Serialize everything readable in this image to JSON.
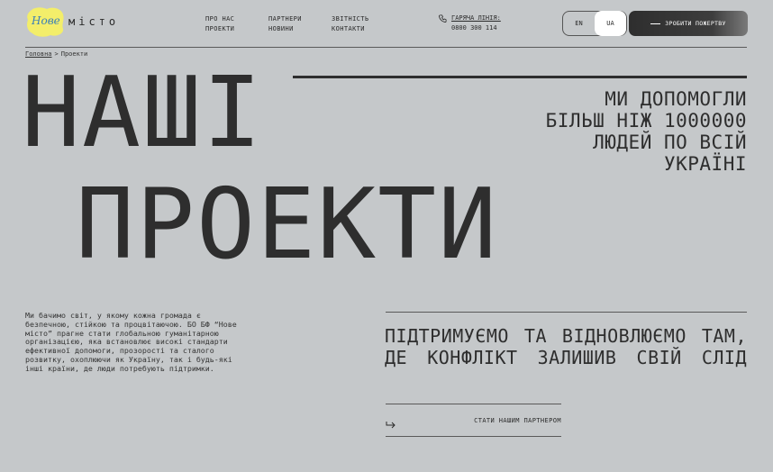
{
  "logo": {
    "script": "Нове",
    "word": "місто"
  },
  "nav": {
    "col1": [
      "ПРО НАС",
      "ПРОЕКТИ"
    ],
    "col2": [
      "ПАРТНЕРИ",
      "НОВИНИ"
    ],
    "col3": [
      "ЗВІТНІСТЬ",
      "КОНТАКТИ"
    ]
  },
  "hotline": {
    "label": "ГАРЯЧА ЛІНІЯ:",
    "phone": "0800 300 114",
    "icon": "phone-icon"
  },
  "languages": {
    "en": "EN",
    "ua": "UA",
    "active": "UA"
  },
  "donate_button": "ЗРОБИТИ ПОЖЕРТВУ",
  "breadcrumb": {
    "home": "Головна",
    "separator": ">",
    "current": "Проекти"
  },
  "hero": {
    "title_line_1": "НАШІ",
    "title_line_2": "ПРОЕКТИ",
    "stat_lines": [
      "МИ ДОПОМОГЛИ",
      "БІЛЬШ НІЖ 1000000",
      "ЛЮДЕЙ ПО ВСІЙ",
      "УКРАЇНІ"
    ]
  },
  "mission_text": "Ми бачимо світ, у якому кожна громада є безпечною, стійкою та процвітаючою. БО БФ “Нове місто” прагне стати глобальною гуманітарною організацією, яка встановлює високі стандарти ефективної допомоги, прозорості та сталого розвитку, охоплюючи як Україну, так і будь-які інші країни, де люди потребують підтримки.",
  "support_text": "ПІДТРИМУЄМО ТА ВІДНОВЛЮЄМО ТАМ, ДЕ КОНФЛІКТ ЗАЛИШИВ СВІЙ СЛІД",
  "partner_cta": {
    "label": "СТАТИ НАШИМ ПАРТНЕРОМ",
    "icon": "arrow-right-icon"
  },
  "colors": {
    "background": "#c5c8ca",
    "text": "#2a2a2a",
    "logo_yellow": "#f3ee6a",
    "logo_blue": "#3b7fb8"
  }
}
